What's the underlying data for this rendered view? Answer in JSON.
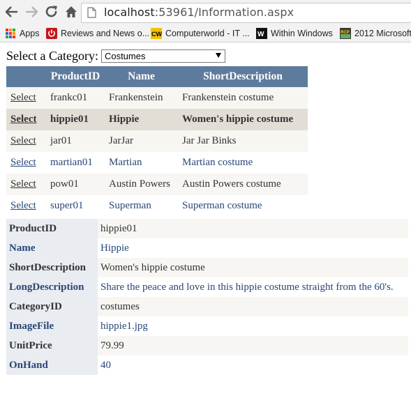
{
  "browser": {
    "url_host": "localhost",
    "url_rest": ":53961/Information.aspx",
    "bookmarks": [
      {
        "label": "Apps",
        "icon": "apps-grid-icon"
      },
      {
        "label": "Reviews and News o...",
        "icon": "power-icon"
      },
      {
        "label": "Computerworld - IT ...",
        "icon": "cw-logo-icon"
      },
      {
        "label": "Within Windows",
        "icon": "w-logo-icon"
      },
      {
        "label": "2012 Microsoft",
        "icon": "rcp-logo-icon"
      }
    ]
  },
  "category": {
    "label": "Select a Category:",
    "selected": "Costumes"
  },
  "grid": {
    "headers": [
      "",
      "ProductID",
      "Name",
      "ShortDescription"
    ],
    "select_label": "Select",
    "rows": [
      {
        "id": "frankc01",
        "name": "Frankenstein",
        "desc": "Frankenstein costume"
      },
      {
        "id": "hippie01",
        "name": "Hippie",
        "desc": "Women's hippie costume"
      },
      {
        "id": "jar01",
        "name": "JarJar",
        "desc": "Jar Jar Binks"
      },
      {
        "id": "martian01",
        "name": "Martian",
        "desc": "Martian costume"
      },
      {
        "id": "pow01",
        "name": "Austin Powers",
        "desc": "Austin Powers costume"
      },
      {
        "id": "super01",
        "name": "Superman",
        "desc": "Superman costume"
      }
    ],
    "selected_index": 1
  },
  "details": [
    {
      "field": "ProductID",
      "value": "hippie01"
    },
    {
      "field": "Name",
      "value": "Hippie"
    },
    {
      "field": "ShortDescription",
      "value": "Women's hippie costume"
    },
    {
      "field": "LongDescription",
      "value": "Share the peace and love in this hippie costume straight from the 60's."
    },
    {
      "field": "CategoryID",
      "value": "costumes"
    },
    {
      "field": "ImageFile",
      "value": "hippie1.jpg"
    },
    {
      "field": "UnitPrice",
      "value": "79.99"
    },
    {
      "field": "OnHand",
      "value": "40"
    }
  ],
  "colors": {
    "header": "#5d7b9d",
    "alt_row": "#f7f6f3",
    "selected_row": "#e2ded6",
    "link_blue": "#284775"
  }
}
